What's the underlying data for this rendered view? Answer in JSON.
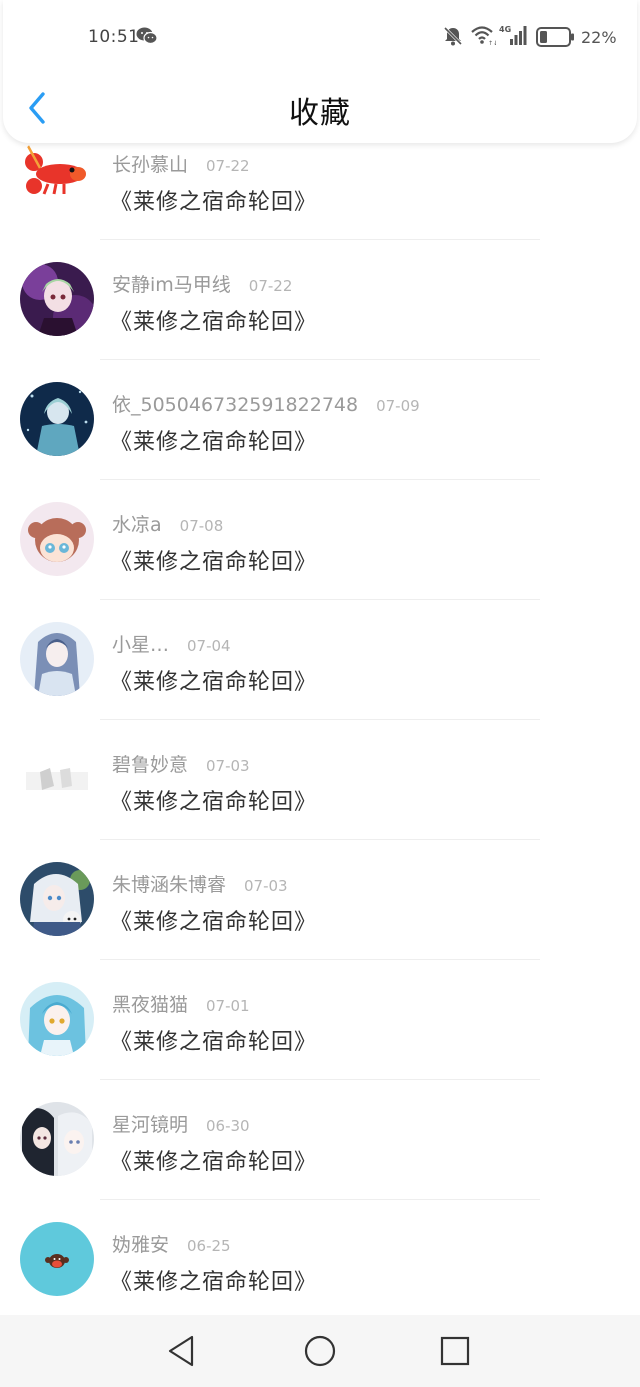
{
  "status_bar": {
    "time": "10:51",
    "network": "4G",
    "battery": "22%"
  },
  "header": {
    "title": "收藏",
    "back_icon": "chevron-left-icon"
  },
  "colors": {
    "accent": "#2a9df4",
    "title_text": "#333333",
    "meta_text": "#9a9a9a"
  },
  "favorites": [
    {
      "username": "长孙慕山",
      "date": "07-22",
      "book": "《莱修之宿命轮回》",
      "avatar": "lobster-avatar"
    },
    {
      "username": "安静im马甲线",
      "date": "07-22",
      "book": "《莱修之宿命轮回》",
      "avatar": "anime-girl-purple-avatar"
    },
    {
      "username": "依_5050467325918227​48",
      "date": "07-09",
      "book": "《莱修之宿命轮回》",
      "avatar": "starry-night-avatar"
    },
    {
      "username": "水凉a",
      "date": "07-08",
      "book": "《莱修之宿命轮回》",
      "avatar": "chibi-girl-avatar"
    },
    {
      "username": "小星…",
      "date": "07-04",
      "book": "《莱修之宿命轮回》",
      "avatar": "blue-hair-avatar"
    },
    {
      "username": "碧鲁妙意",
      "date": "07-03",
      "book": "《莱修之宿命轮回》",
      "avatar": "default-gray-avatar"
    },
    {
      "username": "朱博涵朱博睿",
      "date": "07-03",
      "book": "《莱修之宿命轮回》",
      "avatar": "white-hair-avatar"
    },
    {
      "username": "黑夜猫猫",
      "date": "07-01",
      "book": "《莱修之宿命轮回》",
      "avatar": "teal-hair-avatar"
    },
    {
      "username": "星河镜明",
      "date": "06-30",
      "book": "《莱修之宿命轮回》",
      "avatar": "duo-anime-avatar"
    },
    {
      "username": "妫雅安",
      "date": "06-25",
      "book": "《莱修之宿命轮回》",
      "avatar": "monkey-avatar"
    }
  ],
  "nav": {
    "back": "triangle-back-icon",
    "home": "circle-home-icon",
    "recent": "square-recent-icon"
  }
}
